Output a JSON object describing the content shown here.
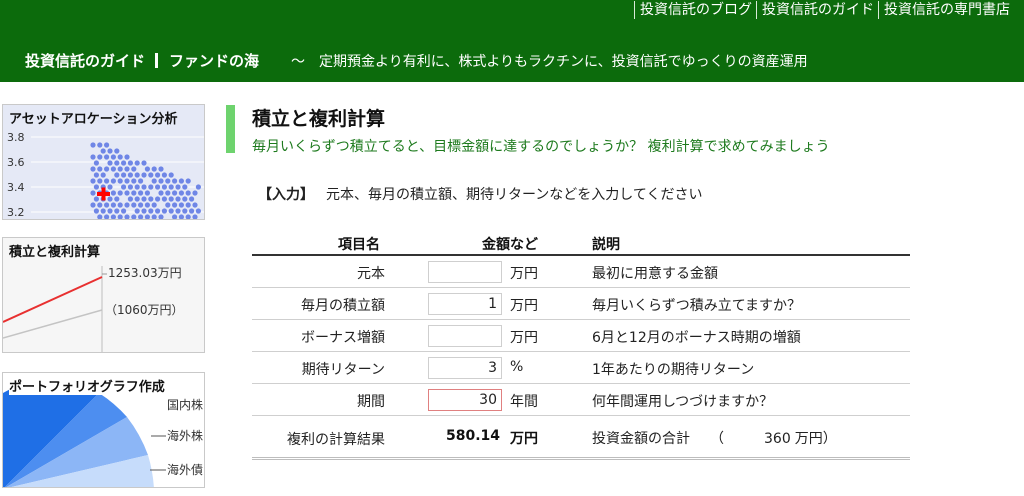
{
  "header": {
    "links": [
      "投資信託のブログ",
      "投資信託のガイド",
      "投資信託の専門書店"
    ],
    "site_title": "投資信託のガイド",
    "site_subtitle": "ファンドの海",
    "tagline": "～　定期預金より有利に、株式よりもラクチンに、投資信託でゆっくりの資産運用"
  },
  "sidebar": {
    "asset": {
      "title": "アセットアロケーション分析",
      "y_ticks": [
        "3.8",
        "3.6",
        "3.4",
        "3.2"
      ]
    },
    "compound": {
      "title": "積立と複利計算",
      "value_top": "1253.03万円",
      "value_bottom": "（1060万円）"
    },
    "portfolio": {
      "title": "ポートフォリオグラフ作成",
      "labels": [
        "国内株",
        "海外株",
        "海外債"
      ]
    }
  },
  "main": {
    "title": "積立と複利計算",
    "description": "毎月いくらずつ積立てると、目標金額に達するのでしょうか？ 複利計算で求めてみましょう",
    "input_tag": "【入力】",
    "input_text": "元本、毎月の積立額、期待リターンなどを入力してください"
  },
  "table": {
    "headers": {
      "item": "項目名",
      "amount": "金額など",
      "desc": "説明"
    },
    "rows": [
      {
        "label": "元本",
        "value": "",
        "unit": "万円",
        "desc": "最初に用意する金額"
      },
      {
        "label": "毎月の積立額",
        "value": "1",
        "unit": "万円",
        "desc": "毎月いくらずつ積み立てますか？"
      },
      {
        "label": "ボーナス増額",
        "value": "",
        "unit": "万円",
        "desc": "6月と12月のボーナス時期の増額"
      },
      {
        "label": "期待リターン",
        "value": "3",
        "unit": "%",
        "desc": "1年あたりの期待リターン"
      },
      {
        "label": "期間",
        "value": "30",
        "unit": "年間",
        "desc": "何年間運用しつづけますか？"
      }
    ],
    "result": {
      "label": "複利の計算結果",
      "value": "580.14",
      "unit": "万円",
      "desc": "投資金額の合計",
      "open_paren": "（",
      "total": "360",
      "total_unit": "万円",
      "close_paren": "）"
    }
  },
  "colors": {
    "header_bg": "#0c6b0c",
    "title_bar": "#6ed36e",
    "desc_text": "#1d7a1d",
    "scatter_dot": "#6f86e6",
    "scatter_marker": "#ff0000",
    "line_red": "#e83030",
    "pie_blue": "#1f6fe6"
  }
}
